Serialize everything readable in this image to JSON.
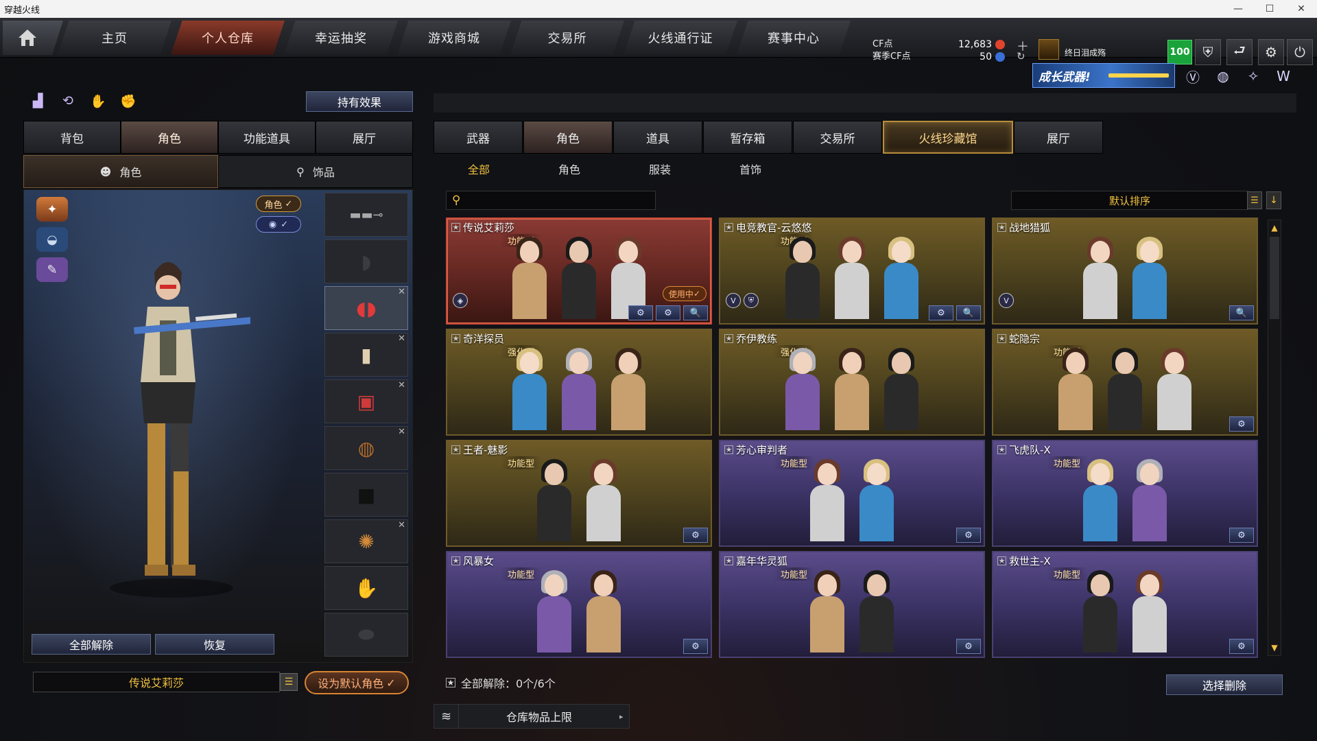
{
  "window": {
    "title": "穿越火线",
    "controls": [
      "—",
      "☐",
      "✕"
    ]
  },
  "nav": {
    "tabs": [
      "主页",
      "个人仓库",
      "幸运抽奖",
      "游戏商城",
      "交易所",
      "火线通行证",
      "赛事中心"
    ],
    "active_index": 1,
    "dot_tabs": [
      3,
      6
    ]
  },
  "currency": {
    "cf_label": "CF点",
    "cf_value": "12,683",
    "season_label": "赛季CF点",
    "season_value": "50",
    "cf_color": "#e0442c",
    "season_color": "#3a6fd8"
  },
  "user": {
    "name": "终日泪成殇",
    "level": "100"
  },
  "top_icons": [
    "shield-icon",
    "exit-icon",
    "gear-icon",
    "power-icon"
  ],
  "banner": {
    "text": "成长武器!"
  },
  "left": {
    "effects_button": "持有效果",
    "tabs": [
      "背包",
      "角色",
      "功能道具",
      "展厅"
    ],
    "active_tab": 1,
    "subtabs": [
      "角色",
      "饰品"
    ],
    "role_tag": "角色",
    "unequip_all": "全部解除",
    "restore": "恢复",
    "character_name": "传说艾莉莎",
    "set_default": "设为默认角色"
  },
  "right": {
    "tabs": [
      "武器",
      "角色",
      "道具",
      "暂存箱",
      "交易所",
      "火线珍藏馆",
      "展厅"
    ],
    "active_tab": 1,
    "gold_tab": 5,
    "subtabs": [
      "全部",
      "角色",
      "服装",
      "首饰"
    ],
    "search_placeholder": "",
    "sort_label": "默认排序",
    "cards": [
      {
        "name": "传说艾莉莎",
        "type": "功能型",
        "theme": "red",
        "in_use": "使用中",
        "buttons": [
          "⚙",
          "⚙",
          "🔍"
        ],
        "figures": 3
      },
      {
        "name": "电竞教官-云悠悠",
        "type": "功能型",
        "theme": "gold",
        "buttons": [
          "⚙",
          "🔍"
        ],
        "figures": 3
      },
      {
        "name": "战地猎狐",
        "type": "",
        "theme": "gold",
        "buttons": [
          "🔍"
        ],
        "figures": 2
      },
      {
        "name": "奇洋探员",
        "type": "强化型",
        "theme": "gold",
        "buttons": [],
        "figures": 3
      },
      {
        "name": "乔伊教练",
        "type": "强化型",
        "theme": "gold",
        "buttons": [],
        "figures": 3
      },
      {
        "name": "蛇隐宗",
        "type": "功能型",
        "theme": "gold",
        "buttons": [
          "⚙"
        ],
        "figures": 3
      },
      {
        "name": "王者-魅影",
        "type": "功能型",
        "theme": "gold",
        "buttons": [
          "⚙"
        ],
        "figures": 2
      },
      {
        "name": "芳心审判者",
        "type": "功能型",
        "theme": "purple",
        "buttons": [
          "⚙"
        ],
        "figures": 2
      },
      {
        "name": "飞虎队-X",
        "type": "功能型",
        "theme": "purple",
        "buttons": [
          "⚙"
        ],
        "figures": 2
      },
      {
        "name": "风暴女",
        "type": "功能型",
        "theme": "purple",
        "buttons": [
          "⚙"
        ],
        "figures": 2
      },
      {
        "name": "嘉年华灵狐",
        "type": "功能型",
        "theme": "purple",
        "buttons": [
          "⚙"
        ],
        "figures": 2
      },
      {
        "name": "救世主-X",
        "type": "功能型",
        "theme": "purple",
        "buttons": [
          "⚙"
        ],
        "figures": 2
      }
    ],
    "footer_label": "全部解除：0个/6个",
    "delete_button": "选择删除",
    "storage_label": "仓库物品上限"
  }
}
